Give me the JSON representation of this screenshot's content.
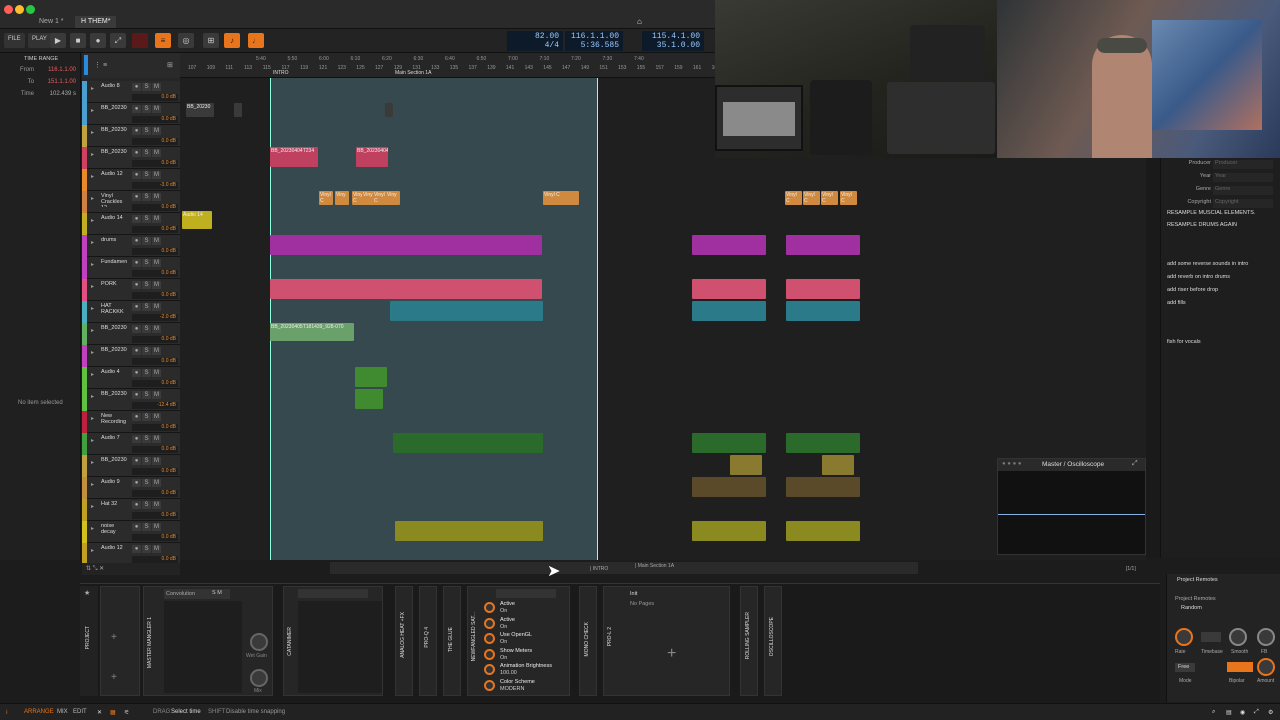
{
  "window": {
    "tabs": [
      "New 1 *",
      "H THEM*"
    ]
  },
  "transport": {
    "file_label": "FILE",
    "play_label": "PLAY",
    "tempo": "82.00",
    "time_sig": "4/4",
    "position_bars": "116.1.1.00",
    "position_time": "5:36.585",
    "loop_start": "115.4.1.00",
    "loop_length": "35.1.0.00"
  },
  "inspector": {
    "header": "TIME RANGE",
    "from_label": "From",
    "from_value": "116.1.1.00",
    "to_label": "To",
    "to_value": "151.1.1.00",
    "time_label": "Time",
    "time_value": "102.439 s",
    "empty_text": "No item selected"
  },
  "ruler": {
    "ticks": [
      "107",
      "109",
      "111",
      "113",
      "115",
      "117",
      "119",
      "121",
      "123",
      "125",
      "127",
      "129",
      "131",
      "133",
      "135",
      "137",
      "139",
      "141",
      "143",
      "145",
      "147",
      "149",
      "151",
      "153",
      "155",
      "157",
      "159",
      "161",
      "163"
    ],
    "times": [
      "5:40",
      "5:50",
      "6:00",
      "6:10",
      "6:20",
      "6:30",
      "6:40",
      "6:50",
      "7:00",
      "7:10",
      "7:20",
      "7:30",
      "7:40"
    ],
    "cue_intro": "INTRO",
    "cue_main": "Main Section 1A"
  },
  "tracks": [
    {
      "name": "Audio 8",
      "db": "0.0 dB",
      "color": "#4a9fd0"
    },
    {
      "name": "BB_20230404T",
      "db": "0.0 dB",
      "color": "#4a9fd0"
    },
    {
      "name": "BB_20230404T",
      "db": "0.0 dB",
      "color": "#c0a040"
    },
    {
      "name": "BB_20230404T",
      "db": "0.0 dB",
      "color": "#d04060"
    },
    {
      "name": "Audio 12",
      "db": "-3.0 dB",
      "color": "#e88a2a"
    },
    {
      "name": "Vinyl Crackles 12",
      "db": "0.0 dB",
      "color": "#d08040"
    },
    {
      "name": "Audio 14",
      "db": "0.0 dB",
      "color": "#c0b020"
    },
    {
      "name": "drums",
      "db": "0.0 dB",
      "color": "#c040c0"
    },
    {
      "name": "Fundamental",
      "db": "0.0 dB",
      "color": "#c040c0"
    },
    {
      "name": "PORK",
      "db": "0.0 dB",
      "color": "#e05080"
    },
    {
      "name": "HAT RACKKK",
      "db": "-2.0 dB",
      "color": "#4ab0c0"
    },
    {
      "name": "BB_20230405",
      "db": "0.0 dB",
      "color": "#60b060"
    },
    {
      "name": "BB_20230405",
      "db": "0.0 dB",
      "color": "#c040c0"
    },
    {
      "name": "Audio 4",
      "db": "0.0 dB",
      "color": "#60c040"
    },
    {
      "name": "BB_20230405",
      "db": "-12.4 dB",
      "color": "#60c040"
    },
    {
      "name": "New Recording",
      "db": "0.0 dB",
      "color": "#c02040"
    },
    {
      "name": "Audio 7",
      "db": "0.0 dB",
      "color": "#40a040"
    },
    {
      "name": "BB_20230405",
      "db": "0.0 dB",
      "color": "#c0a040"
    },
    {
      "name": "Audio 9",
      "db": "0.0 dB",
      "color": "#c09040"
    },
    {
      "name": "Hat 32",
      "db": "0.0 dB",
      "color": "#c0a020"
    },
    {
      "name": "noise decay",
      "db": "0.0 dB",
      "color": "#d0c020"
    },
    {
      "name": "Audio 12",
      "db": "0.0 dB",
      "color": "#c0a020"
    }
  ],
  "clips": {
    "bb1": "BB_20230",
    "bb_red1": "BB_20230404T234",
    "bb_red2": "BB_20230404",
    "vinyl": [
      "Vinyl C",
      "Viny",
      "Vinyl C",
      "Viny",
      "Vinyl C",
      "Viny"
    ],
    "vinyl_right": [
      "Vinyl C",
      "Vinyl C",
      "Vinyl C",
      "Vinyl C"
    ],
    "vinyl_mid": "Vinyl C",
    "audio14": "Audio 14",
    "bb_green": "BB_20230405T181439_928-070"
  },
  "right_panel": {
    "meta": [
      {
        "k": "Producer",
        "v": "Producer"
      },
      {
        "k": "Year",
        "v": "Year"
      },
      {
        "k": "Genre",
        "v": "Genre"
      },
      {
        "k": "Copyright",
        "v": "Copyright"
      }
    ],
    "notes": [
      "RESAMPLE MUSCIAL ELEMENTS.",
      "RESAMPLE DRUMS AGAIN",
      "add some reverse sounds in intro",
      "add reverb on intro drums",
      "add riser before drop",
      "add fills",
      "fish for vocals"
    ]
  },
  "oscilloscope": {
    "title": "Master / Oscilloscope"
  },
  "arrange_footer": {
    "intro": "| INTRO",
    "main": "| Main Section 1A",
    "page": "[1/1]"
  },
  "devices": {
    "project_label": "PROJECT",
    "master_mangler": "MASTER MANGLER 1",
    "convolution": "Convolution",
    "wet_gain": "Wet Gain",
    "mix": "Mix",
    "catanimer": "CATANIMER",
    "analog_heat": "ANALOG HEAT +FX",
    "pro_q": "PRO-Q 4",
    "the_glue": "THE GLUE",
    "newfangled": "NEWFANGLED SAT...",
    "mono_check": "MONO CHECK",
    "pro_l": "PRO-L 2",
    "rolling_sampler": "ROLLING SAMPLER",
    "oscilloscope": "OSCILLOSCOPE",
    "params": [
      {
        "name": "Active",
        "value": "On"
      },
      {
        "name": "Active",
        "value": "On"
      },
      {
        "name": "Use OpenGL",
        "value": "On"
      },
      {
        "name": "Show Meters",
        "value": "On"
      },
      {
        "name": "Animation Brightness",
        "value": "100.00"
      },
      {
        "name": "Color Scheme",
        "value": "MODERN"
      }
    ],
    "init_label": "Init",
    "no_pages": "No Pages"
  },
  "remotes": {
    "title": "Project Remotes",
    "subtitle": "Project Remotes",
    "random": "Random",
    "knobs": [
      "Rate",
      "Timebase",
      "Smooth",
      "FB"
    ],
    "free": "Free",
    "mode": "Mode",
    "bipolar": "Bipolar",
    "amount": "Amount"
  },
  "status": {
    "arrange": "ARRANGE",
    "mix": "MIX",
    "edit": "EDIT",
    "drag_key": "DRAG",
    "drag_desc": "Select time",
    "shift_key": "SHIFT",
    "shift_desc": "Disable time snapping"
  },
  "colors": {
    "accent": "#e8741c",
    "loop": "#78c8dc"
  }
}
